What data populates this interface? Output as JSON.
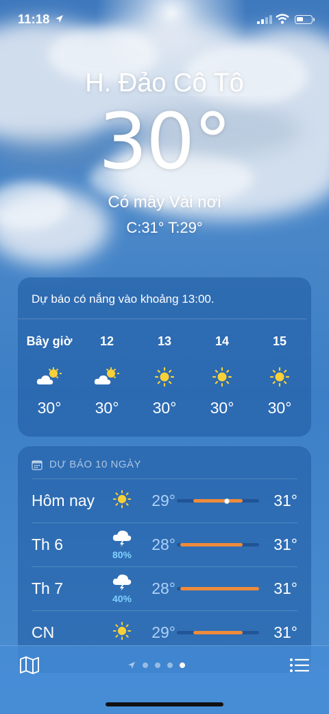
{
  "status_bar": {
    "time": "11:18"
  },
  "location": {
    "name": "H. Đảo Cô Tô"
  },
  "current": {
    "temperature": "30°",
    "condition": "Có mây Vài nơi",
    "high_low": "C:31°  T:29°"
  },
  "hourly": {
    "summary": "Dự báo có nắng vào khoảng 13:00.",
    "items": [
      {
        "label": "Bây giờ",
        "icon": "partly-cloudy-icon",
        "temp": "30°"
      },
      {
        "label": "12",
        "icon": "partly-cloudy-icon",
        "temp": "30°"
      },
      {
        "label": "13",
        "icon": "sun-icon",
        "temp": "30°"
      },
      {
        "label": "14",
        "icon": "sun-icon",
        "temp": "30°"
      },
      {
        "label": "15",
        "icon": "sun-icon",
        "temp": "30°"
      }
    ]
  },
  "daily": {
    "header": "DỰ BÁO 10 NGÀY",
    "items": [
      {
        "day": "Hôm nay",
        "icon": "sun-icon",
        "precip": "",
        "low": "29°",
        "high": "31°",
        "range_start": 0.2,
        "range_end": 0.8,
        "current_marker": 0.6
      },
      {
        "day": "Th 6",
        "icon": "thunderstorm-icon",
        "precip": "80%",
        "low": "28°",
        "high": "31°",
        "range_start": 0.04,
        "range_end": 0.8
      },
      {
        "day": "Th 7",
        "icon": "thunderstorm-icon",
        "precip": "40%",
        "low": "28°",
        "high": "31°",
        "range_start": 0.04,
        "range_end": 1.0
      },
      {
        "day": "CN",
        "icon": "sun-icon",
        "precip": "",
        "low": "29°",
        "high": "31°",
        "range_start": 0.2,
        "range_end": 0.8
      }
    ]
  },
  "colors": {
    "range_bar": "#ef8b3a",
    "precip": "#7fd0ff",
    "sun": "#f8d038"
  }
}
